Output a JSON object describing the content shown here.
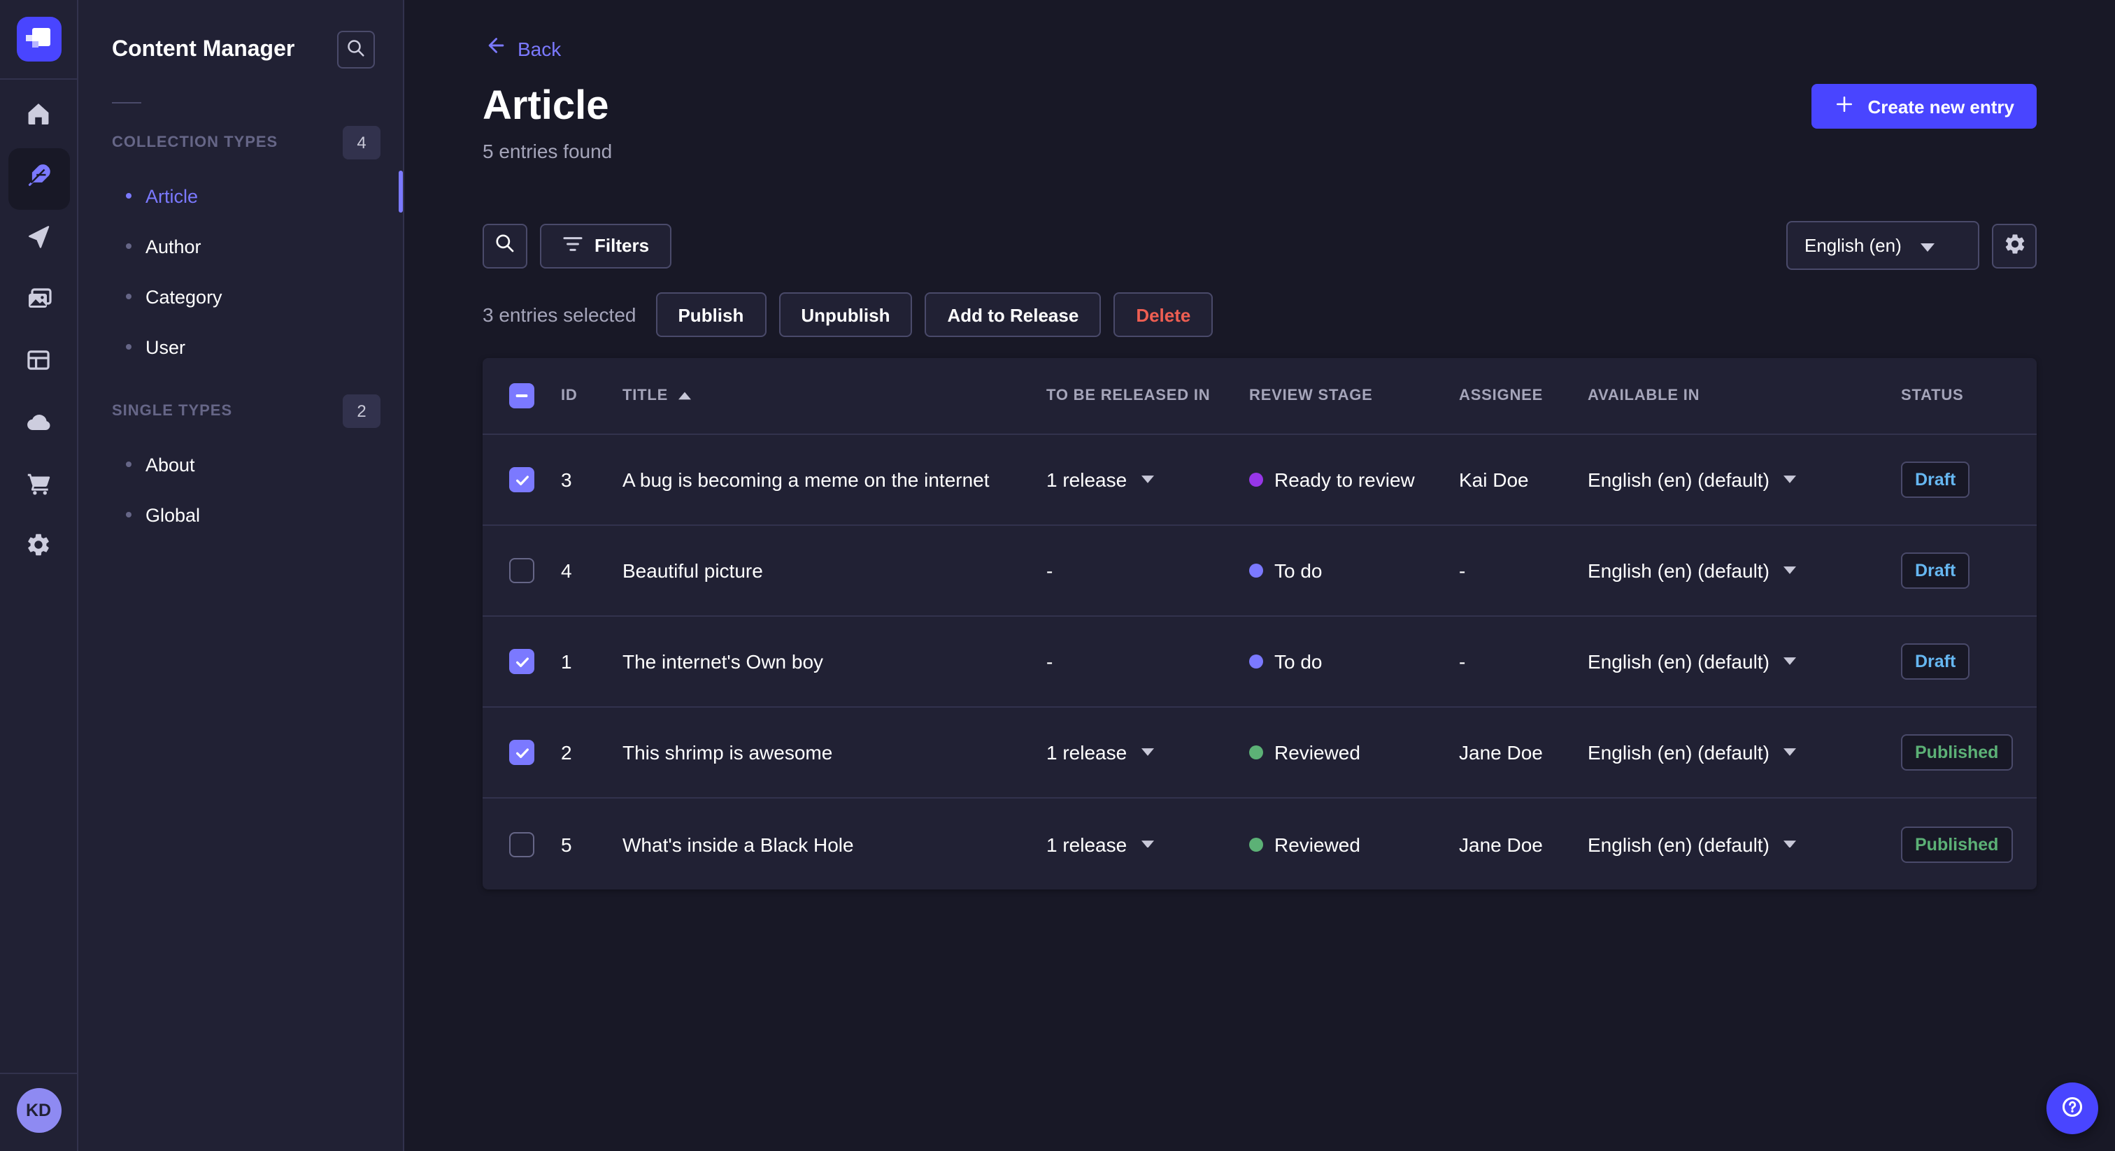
{
  "sidebar": {
    "title": "Content Manager",
    "sections": [
      {
        "label": "COLLECTION TYPES",
        "count": "4",
        "items": [
          {
            "label": "Article",
            "active": true
          },
          {
            "label": "Author",
            "active": false
          },
          {
            "label": "Category",
            "active": false
          },
          {
            "label": "User",
            "active": false
          }
        ]
      },
      {
        "label": "SINGLE TYPES",
        "count": "2",
        "items": [
          {
            "label": "About",
            "active": false
          },
          {
            "label": "Global",
            "active": false
          }
        ]
      }
    ],
    "avatar_initials": "KD"
  },
  "rail": {
    "icons": [
      "home-icon",
      "feather-icon",
      "send-icon",
      "media-icon",
      "layout-icon",
      "cloud-icon",
      "cart-icon",
      "settings-icon"
    ],
    "active_icon": "feather-icon"
  },
  "header": {
    "back_label": "Back",
    "title": "Article",
    "subtitle": "5 entries found",
    "create_button": "Create new entry"
  },
  "toolbar": {
    "filters_label": "Filters",
    "locale": "English (en)"
  },
  "bulkbar": {
    "selected_text": "3 entries selected",
    "publish": "Publish",
    "unpublish": "Unpublish",
    "add_to_release": "Add to Release",
    "delete": "Delete"
  },
  "table": {
    "columns": [
      "ID",
      "TITLE",
      "TO BE RELEASED IN",
      "REVIEW STAGE",
      "ASSIGNEE",
      "AVAILABLE IN",
      "STATUS"
    ],
    "sorted_column": "TITLE",
    "rows": [
      {
        "checked": true,
        "id": "3",
        "title": "A bug is becoming a meme on the internet",
        "release": "1 release",
        "review_stage": "Ready to review",
        "review_color": "#9736e8",
        "assignee": "Kai Doe",
        "available": "English (en) (default)",
        "status": "Draft"
      },
      {
        "checked": false,
        "id": "4",
        "title": "Beautiful picture",
        "release": "-",
        "review_stage": "To do",
        "review_color": "#7b79ff",
        "assignee": "-",
        "available": "English (en) (default)",
        "status": "Draft"
      },
      {
        "checked": true,
        "id": "1",
        "title": "The internet's Own boy",
        "release": "-",
        "review_stage": "To do",
        "review_color": "#7b79ff",
        "assignee": "-",
        "available": "English (en) (default)",
        "status": "Draft"
      },
      {
        "checked": true,
        "id": "2",
        "title": "This shrimp is awesome",
        "release": "1 release",
        "review_stage": "Reviewed",
        "review_color": "#5cb176",
        "assignee": "Jane Doe",
        "available": "English (en) (default)",
        "status": "Published"
      },
      {
        "checked": false,
        "id": "5",
        "title": "What's inside a Black Hole",
        "release": "1 release",
        "review_stage": "Reviewed",
        "review_color": "#5cb176",
        "assignee": "Jane Doe",
        "available": "English (en) (default)",
        "status": "Published"
      }
    ]
  },
  "colors": {
    "app_bg": "#181826",
    "panel_bg": "#212134",
    "border": "#32324d",
    "input_border": "#4a4a6a",
    "primary": "#4945ff",
    "primary_light": "#7b79ff",
    "text_secondary": "#a5a5ba",
    "danger": "#ee5e52",
    "status_draft": "#66b7f1",
    "status_published": "#5cb176",
    "review_todo": "#7b79ff",
    "review_ready": "#9736e8",
    "review_reviewed": "#5cb176"
  }
}
